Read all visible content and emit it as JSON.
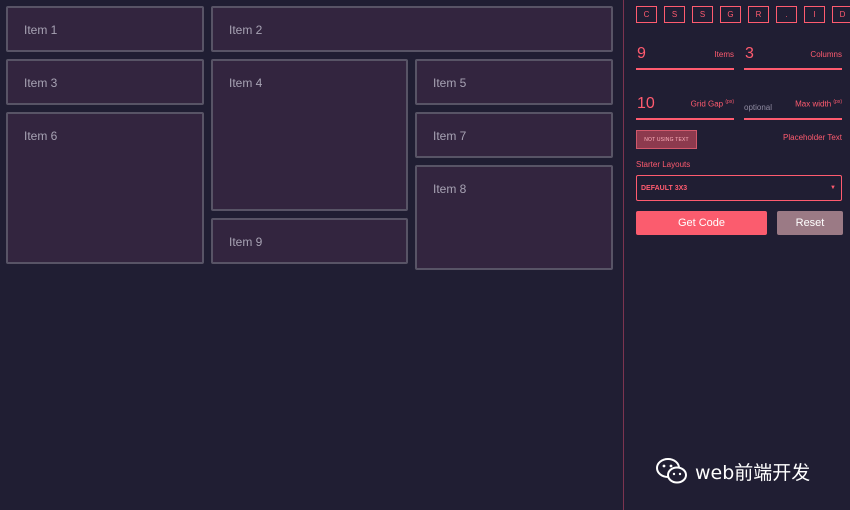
{
  "grid": {
    "items": [
      {
        "label": "Item 1"
      },
      {
        "label": "Item 2"
      },
      {
        "label": "Item 3"
      },
      {
        "label": "Item 4"
      },
      {
        "label": "Item 5"
      },
      {
        "label": "Item 6"
      },
      {
        "label": "Item 7"
      },
      {
        "label": "Item 8"
      },
      {
        "label": "Item 9"
      }
    ]
  },
  "panel": {
    "logo_letters": [
      "C",
      "S",
      "S",
      "G",
      "R",
      ".",
      "I",
      "D"
    ],
    "items_field": {
      "value": "9",
      "label": "Items"
    },
    "columns_field": {
      "value": "3",
      "label": "Columns"
    },
    "gap_field": {
      "value": "10",
      "label": "Grid Gap",
      "unit": "(px)"
    },
    "maxwidth_field": {
      "placeholder": "optional",
      "label": "Max width",
      "unit": "(px)"
    },
    "text_toggle": "NOT USING TEXT",
    "placeholder_text_label": "Placeholder Text",
    "starter_label": "Starter Layouts",
    "starter_value": "DEFAULT 3X3",
    "starter_caret": "▼",
    "get_code": "Get Code",
    "reset": "Reset"
  },
  "watermark": {
    "text": "web前端开发"
  },
  "colors": {
    "background": "#201e33",
    "item_bg": "#33253f",
    "item_border": "#585466",
    "accent": "#ff5b6f",
    "reset_button": "#9b7a85"
  }
}
